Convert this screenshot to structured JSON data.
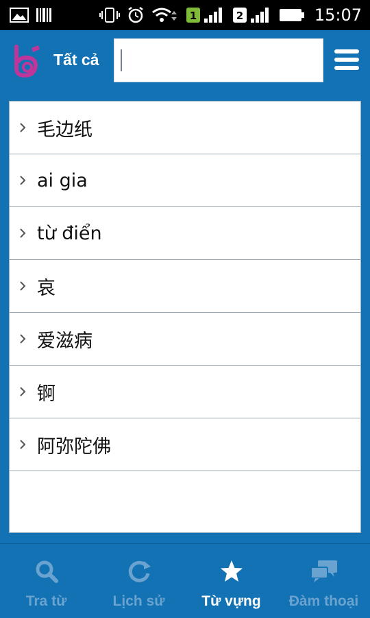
{
  "status_bar": {
    "time": "15:07",
    "sim1_label": "1",
    "sim2_label": "2",
    "icons": [
      "image-icon",
      "barcode-icon",
      "vibrate-icon",
      "alarm-icon",
      "wifi-icon",
      "sim1-signal-icon",
      "sim2-signal-icon",
      "battery-icon"
    ]
  },
  "app_bar": {
    "filter_label": "Tất cả",
    "search_value": "",
    "search_placeholder": ""
  },
  "list": {
    "items": [
      {
        "label": " 毛边纸"
      },
      {
        "label": "ai gia"
      },
      {
        "label": "từ điển"
      },
      {
        "label": "哀"
      },
      {
        "label": "爱滋病"
      },
      {
        "label": "锕"
      },
      {
        "label": "阿弥陀佛"
      }
    ]
  },
  "bottom_nav": {
    "tabs": [
      {
        "label": "Tra từ",
        "icon": "search-icon",
        "active": false
      },
      {
        "label": "Lịch sử",
        "icon": "history-icon",
        "active": false
      },
      {
        "label": "Từ vựng",
        "icon": "star-icon",
        "active": true
      },
      {
        "label": "Đàm thoại",
        "icon": "chat-icon",
        "active": false
      }
    ]
  },
  "colors": {
    "primary": "#1272b4",
    "inactive_tab": "#6aa3cf",
    "active_tab": "#ffffff",
    "logo": "#c0359a"
  }
}
